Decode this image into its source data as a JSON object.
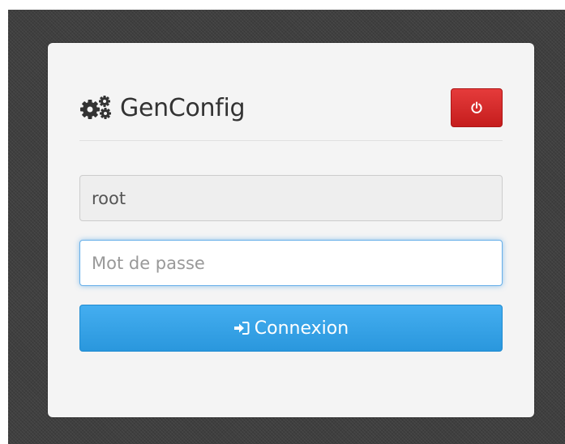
{
  "app": {
    "title": "GenConfig",
    "brand_icon": "gears-icon"
  },
  "header": {
    "power_icon": "power-icon",
    "power_button_color": "#d9282a"
  },
  "form": {
    "username_value": "root",
    "password_placeholder": "Mot de passe",
    "password_value": "",
    "submit_label": "Connexion",
    "submit_icon": "sign-in-icon",
    "submit_color": "#3aa5e8",
    "focus_color": "#66afe9"
  }
}
